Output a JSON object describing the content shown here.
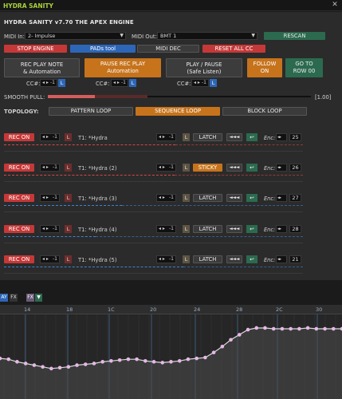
{
  "window": {
    "title": "HYDRA SANITY",
    "close": "✕"
  },
  "header": {
    "title": "HYDRA SANITY v7.70 THE APEX ENGINE"
  },
  "midi": {
    "in_label": "MIDI In:",
    "in_value": "2- Impulse",
    "out_label": "MIDI Out:",
    "out_value": "BMT 1",
    "rescan": "RESCAN"
  },
  "toolbar": {
    "stop_engine": "STOP ENGINE",
    "pads_tool": "PADs tool",
    "midi_dec": "MIDI DEC",
    "reset_all_cc": "RESET ALL CC"
  },
  "actions": {
    "rec_play_note": {
      "line1": "REC PLAY NOTE",
      "line2": "& Automation"
    },
    "pause_rec_play": {
      "line1": "PAUSE REC PLAY",
      "line2": "Automation"
    },
    "play_pause": {
      "line1": "PLAY / PAUSE",
      "line2": "(Safe Listen)"
    },
    "follow_on": {
      "line1": "FOLLOW",
      "line2": "ON"
    },
    "go_to_row": {
      "line1": "GO TO",
      "line2": "ROW 00"
    }
  },
  "cc_controls": [
    {
      "label": "CC#:",
      "value": "-1",
      "tag": "L"
    },
    {
      "label": "CC#:",
      "value": "-1",
      "tag": "L"
    },
    {
      "label": "CC#:",
      "value": "-1",
      "tag": "L"
    }
  ],
  "smooth_pull": {
    "label": "SMOOTH PULL:",
    "value": "[1.00]",
    "level": 0.47
  },
  "topology": {
    "label": "TOPOLOGY:",
    "options": [
      "PATTERN LOOP",
      "SEQUENCE LOOP",
      "BLOCK LOOP"
    ],
    "selected": "SEQUENCE LOOP"
  },
  "tracks": [
    {
      "rec": "REC ON",
      "value": "-1",
      "tag": "L",
      "name": "T1: *Hydra",
      "latch": "LATCH",
      "rew": "◄◄◄",
      "undo": "↩",
      "enc_label": "Enc:",
      "enc_value": "25",
      "color": "#d64545"
    },
    {
      "rec": "REC ON",
      "value": "-1",
      "tag": "L",
      "name": "T1: *Hydra (2)",
      "latch": "STICKY",
      "rew": "◄◄◄",
      "undo": "↩",
      "enc_label": "Enc:",
      "enc_value": "26",
      "color": "#d64545"
    },
    {
      "rec": "REC ON",
      "value": "-1",
      "tag": "L",
      "name": "T1: *Hydra (3)",
      "latch": "LATCH",
      "rew": "◄◄◄",
      "undo": "↩",
      "enc_label": "Enc:",
      "enc_value": "27",
      "color": "#3b82d6"
    },
    {
      "rec": "REC ON",
      "value": "-1",
      "tag": "L",
      "name": "T1: *Hydra (4)",
      "latch": "LATCH",
      "rew": "◄◄◄",
      "undo": "↩",
      "enc_label": "Enc:",
      "enc_value": "28",
      "color": "#3b82d6"
    },
    {
      "rec": "REC ON",
      "value": "-1",
      "tag": "L",
      "name": "T1: *Hydra (5)",
      "latch": "LATCH",
      "rew": "◄◄◄",
      "undo": "↩",
      "enc_label": "Enc:",
      "enc_value": "21",
      "color": "#3b82d6"
    }
  ],
  "bottom_tabs": [
    "AY",
    "FX",
    "FX"
  ],
  "automation": {
    "ruler": [
      "14",
      "18",
      "1C",
      "20",
      "24",
      "28",
      "2C",
      "30"
    ],
    "points": [
      0.52,
      0.53,
      0.56,
      0.58,
      0.6,
      0.62,
      0.64,
      0.63,
      0.62,
      0.6,
      0.59,
      0.58,
      0.56,
      0.55,
      0.54,
      0.53,
      0.53,
      0.55,
      0.56,
      0.57,
      0.56,
      0.55,
      0.53,
      0.52,
      0.51,
      0.45,
      0.38,
      0.3,
      0.24,
      0.18,
      0.16,
      0.16,
      0.17,
      0.17,
      0.17,
      0.17,
      0.16,
      0.17,
      0.17,
      0.17,
      0.17
    ]
  }
}
